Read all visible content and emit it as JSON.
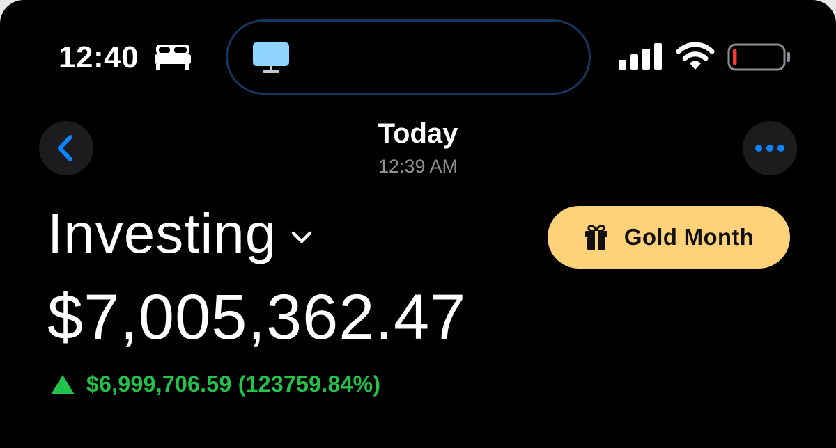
{
  "status_bar": {
    "time": "12:40",
    "focus_icon": "bed-icon",
    "island_icon": "tv-icon",
    "signal_icon": "cellular-signal-icon",
    "wifi_icon": "wifi-icon",
    "battery_icon": "battery-low-icon",
    "battery_level": 0.08,
    "battery_color": "#ff3b30"
  },
  "header": {
    "title": "Today",
    "subtitle": "12:39 AM",
    "back_icon": "chevron-left-icon",
    "more_icon": "ellipsis-icon",
    "accent_color": "#0a84ff"
  },
  "account": {
    "name": "Investing",
    "dropdown_icon": "chevron-down-icon",
    "balance": "$7,005,362.47",
    "change_text": "$6,999,706.59 (123759.84%)",
    "change_icon": "up-triangle-icon",
    "change_color": "#23c34b"
  },
  "promo": {
    "label": "Gold Month",
    "icon": "gift-icon",
    "background_color": "#ffd27a"
  }
}
